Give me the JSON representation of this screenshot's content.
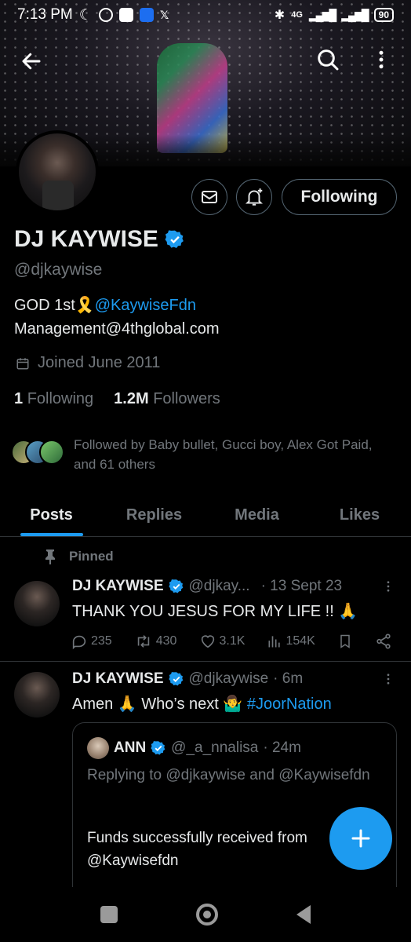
{
  "status_bar": {
    "time": "7:13 PM",
    "network": "4G",
    "battery": "90"
  },
  "header": {
    "back_icon": "arrow-left-icon",
    "search_icon": "search-icon",
    "more_icon": "more-vertical-icon"
  },
  "profile": {
    "name": "DJ KAYWISE",
    "handle": "@djkaywise",
    "bio_prefix": "GOD 1st🎗️",
    "bio_link": "@KaywiseFdn",
    "bio_line2": "Management@4thglobal.com",
    "joined": "Joined June 2011",
    "following_count": "1",
    "following_label": "Following",
    "followers_count": "1.2M",
    "followers_label": "Followers",
    "followed_by": "Followed by Baby bullet, Gucci boy, Alex Got Paid, and 61 others",
    "following_button": "Following",
    "verified_color": "#1d9bf0"
  },
  "tabs": [
    {
      "label": "Posts",
      "active": true
    },
    {
      "label": "Replies",
      "active": false
    },
    {
      "label": "Media",
      "active": false
    },
    {
      "label": "Likes",
      "active": false
    }
  ],
  "pinned_label": "Pinned",
  "posts": [
    {
      "name": "DJ KAYWISE",
      "handle": "@djkay...",
      "time": "· 13 Sept 23",
      "text": "THANK YOU JESUS FOR MY LIFE !! 🙏",
      "replies": "235",
      "reposts": "430",
      "likes": "3.1K",
      "views": "154K"
    },
    {
      "name": "DJ KAYWISE",
      "handle": "@djkaywise",
      "time": "· 6m",
      "text_prefix": "Amen 🙏 Who’s next 🤷‍♂️ ",
      "hashtag": "#JoorNation",
      "quote": {
        "name": "ANN",
        "handle": "@_a_nnalisa",
        "time": "· 24m",
        "replying": "Replying to @djkaywise and @Kaywisefdn",
        "body": "Funds successfully received from @Kaywisefdn"
      }
    }
  ],
  "fab_icon": "plus-icon",
  "accent_color": "#1d9bf0"
}
